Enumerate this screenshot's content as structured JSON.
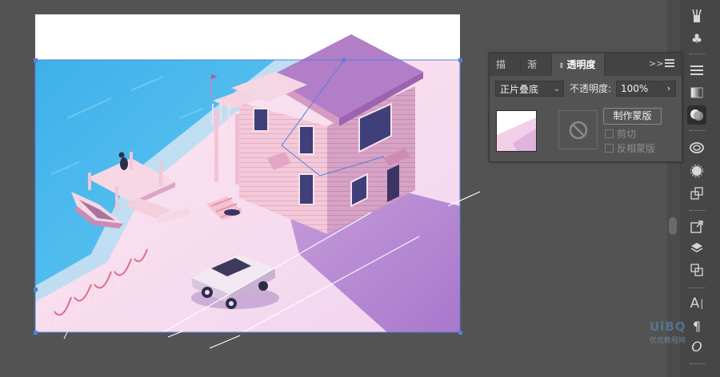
{
  "panel": {
    "tabs": [
      {
        "label": "描边"
      },
      {
        "label": "渐变"
      },
      {
        "label": "透明度"
      }
    ],
    "collapse_glyph": ">>",
    "blend_mode": "正片叠底",
    "opacity_label": "不透明度:",
    "opacity_value": "100%",
    "make_mask_label": "制作蒙版",
    "clip_label": "剪切",
    "invert_mask_label": "反相蒙版",
    "clip_checked": false,
    "invert_checked": false
  },
  "dock": {
    "icons": [
      "brush-icon",
      "club-symbol-icon",
      "stroke-lines-icon",
      "gradient-icon",
      "transparency-icon",
      "cc-libraries-icon",
      "appearance-icon",
      "image-trace-icon",
      "export-icon",
      "layers-icon",
      "artboards-icon",
      "character-icon",
      "paragraph-icon",
      "opentype-icon"
    ]
  },
  "colors": {
    "selection": "#4f7fe0",
    "water": "#4cb8ec",
    "house_roof": "#b07cc4",
    "house_wall": "#f2c6d6",
    "shadow": "#b78ad0"
  },
  "watermark": {
    "main": "UiBQ",
    "sub": "优优教程网"
  }
}
